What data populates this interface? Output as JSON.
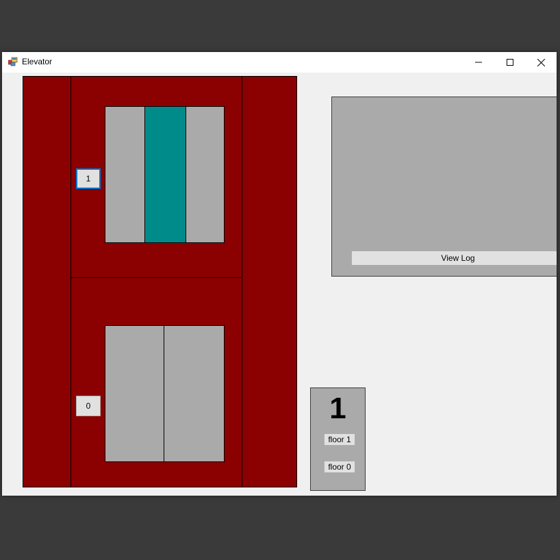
{
  "window": {
    "title": "Elevator"
  },
  "icons": {
    "app": "app-window-icon",
    "minimize": "minimize-icon",
    "maximize": "maximize-icon",
    "close": "close-icon"
  },
  "shaft": {
    "floors": [
      {
        "call_label": "1",
        "door_state": "open"
      },
      {
        "call_label": "0",
        "door_state": "closed"
      }
    ]
  },
  "log": {
    "view_label": "View Log"
  },
  "control": {
    "current_floor": "1",
    "floor1_label": "floor 1",
    "floor0_label": "floor 0"
  },
  "colors": {
    "desktop": "#3a3a3a",
    "shaft": "#8b0000",
    "door": "#aaaaaa",
    "elevator_car": "#008b8b",
    "panel": "#aaaaaa",
    "window_bg": "#f0f0f0"
  }
}
